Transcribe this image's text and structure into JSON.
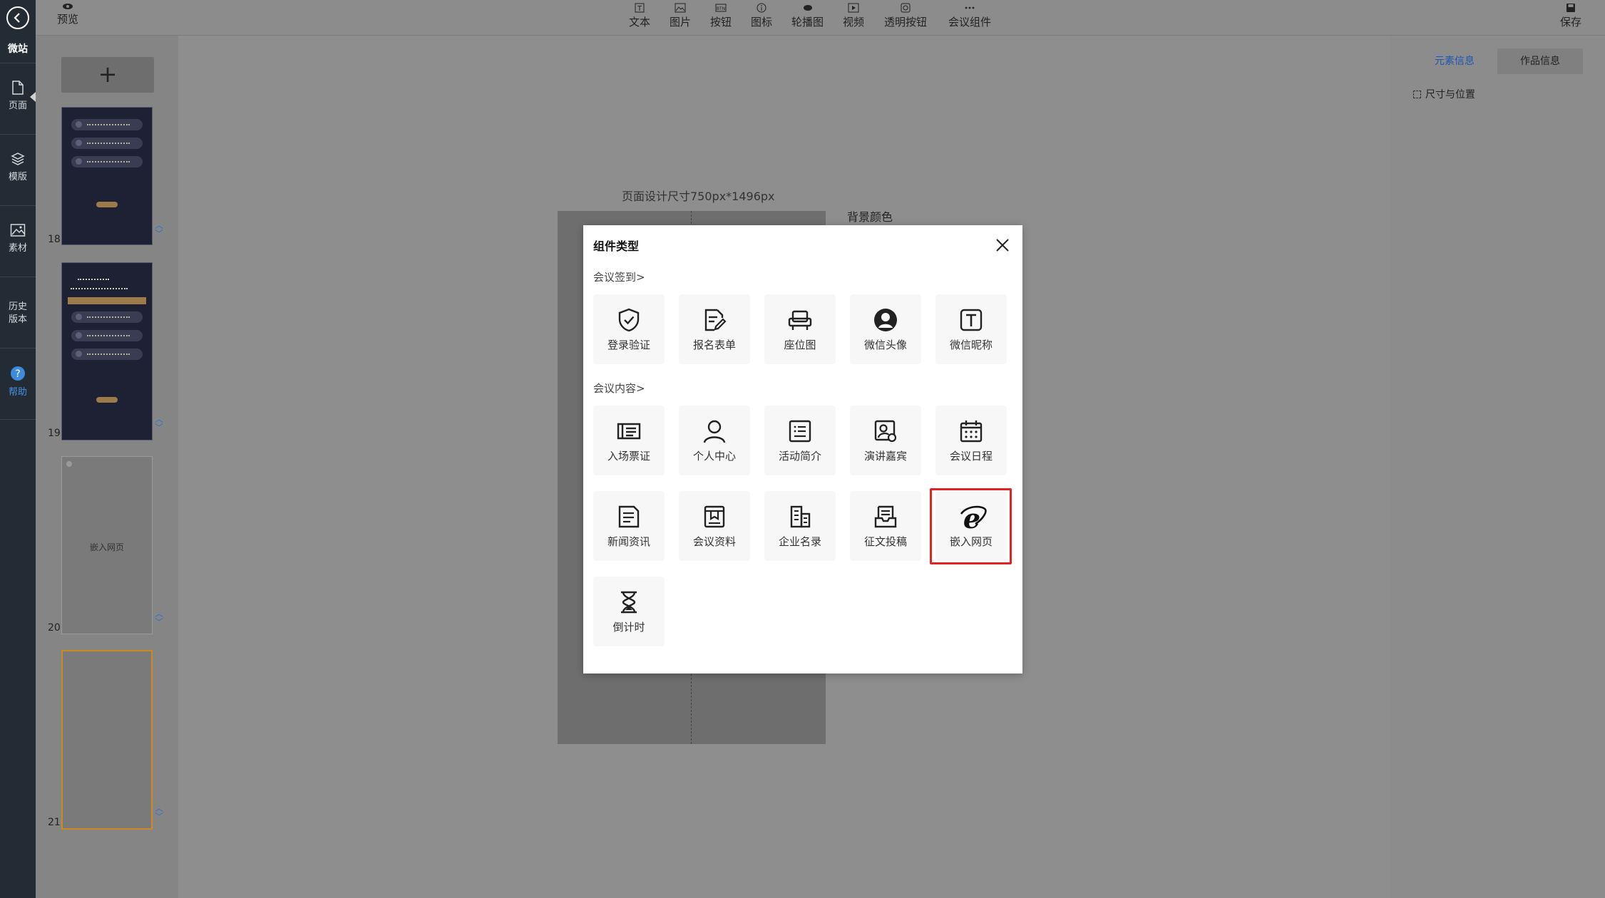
{
  "rail": {
    "brand": "微站",
    "items": [
      {
        "label": "页面",
        "icon": "page-icon"
      },
      {
        "label": "模版",
        "icon": "layers-icon"
      },
      {
        "label": "素材",
        "icon": "image-icon"
      },
      {
        "label": "历史\n版本",
        "icon": "history-icon"
      },
      {
        "label": "帮助",
        "icon": "help-icon"
      }
    ],
    "history_line1": "历史",
    "history_line2": "版本"
  },
  "toolbar": {
    "preview": "预览",
    "tools": [
      "文本",
      "图片",
      "按钮",
      "图标",
      "轮播图",
      "视频",
      "透明按钮",
      "会议组件"
    ],
    "save": "保存"
  },
  "pages": {
    "add_symbol": "+",
    "thumbs": [
      {
        "number": "18"
      },
      {
        "number": "19"
      },
      {
        "number": "20",
        "text": "嵌入网页"
      },
      {
        "number": "21"
      }
    ]
  },
  "canvas": {
    "design_size": "页面设计尺寸750px*1496px",
    "bg_color_label": "背景颜色"
  },
  "right_panel": {
    "tab_element": "元素信息",
    "tab_work": "作品信息",
    "size_position": "尺寸与位置"
  },
  "modal": {
    "title": "组件类型",
    "section1": "会议签到>",
    "section2": "会议内容>",
    "sign_items": [
      {
        "label": "登录验证",
        "icon": "shield-check-icon"
      },
      {
        "label": "报名表单",
        "icon": "form-edit-icon"
      },
      {
        "label": "座位图",
        "icon": "seat-icon"
      },
      {
        "label": "微信头像",
        "icon": "avatar-icon"
      },
      {
        "label": "微信昵称",
        "icon": "text-icon"
      }
    ],
    "content_items": [
      {
        "label": "入场票证",
        "icon": "ticket-icon"
      },
      {
        "label": "个人中心",
        "icon": "user-icon"
      },
      {
        "label": "活动简介",
        "icon": "intro-icon"
      },
      {
        "label": "演讲嘉宾",
        "icon": "speaker-icon"
      },
      {
        "label": "会议日程",
        "icon": "calendar-icon"
      },
      {
        "label": "新闻资讯",
        "icon": "news-icon"
      },
      {
        "label": "会议资料",
        "icon": "document-icon"
      },
      {
        "label": "企业名录",
        "icon": "company-icon"
      },
      {
        "label": "征文投稿",
        "icon": "submission-icon"
      },
      {
        "label": "嵌入网页",
        "icon": "ie-browser-icon"
      },
      {
        "label": "倒计时",
        "icon": "hourglass-icon"
      }
    ]
  },
  "colors": {
    "highlight": "#e02424",
    "active_tab": "#1e56b4",
    "selected_thumb_border": "#c98b1e"
  }
}
